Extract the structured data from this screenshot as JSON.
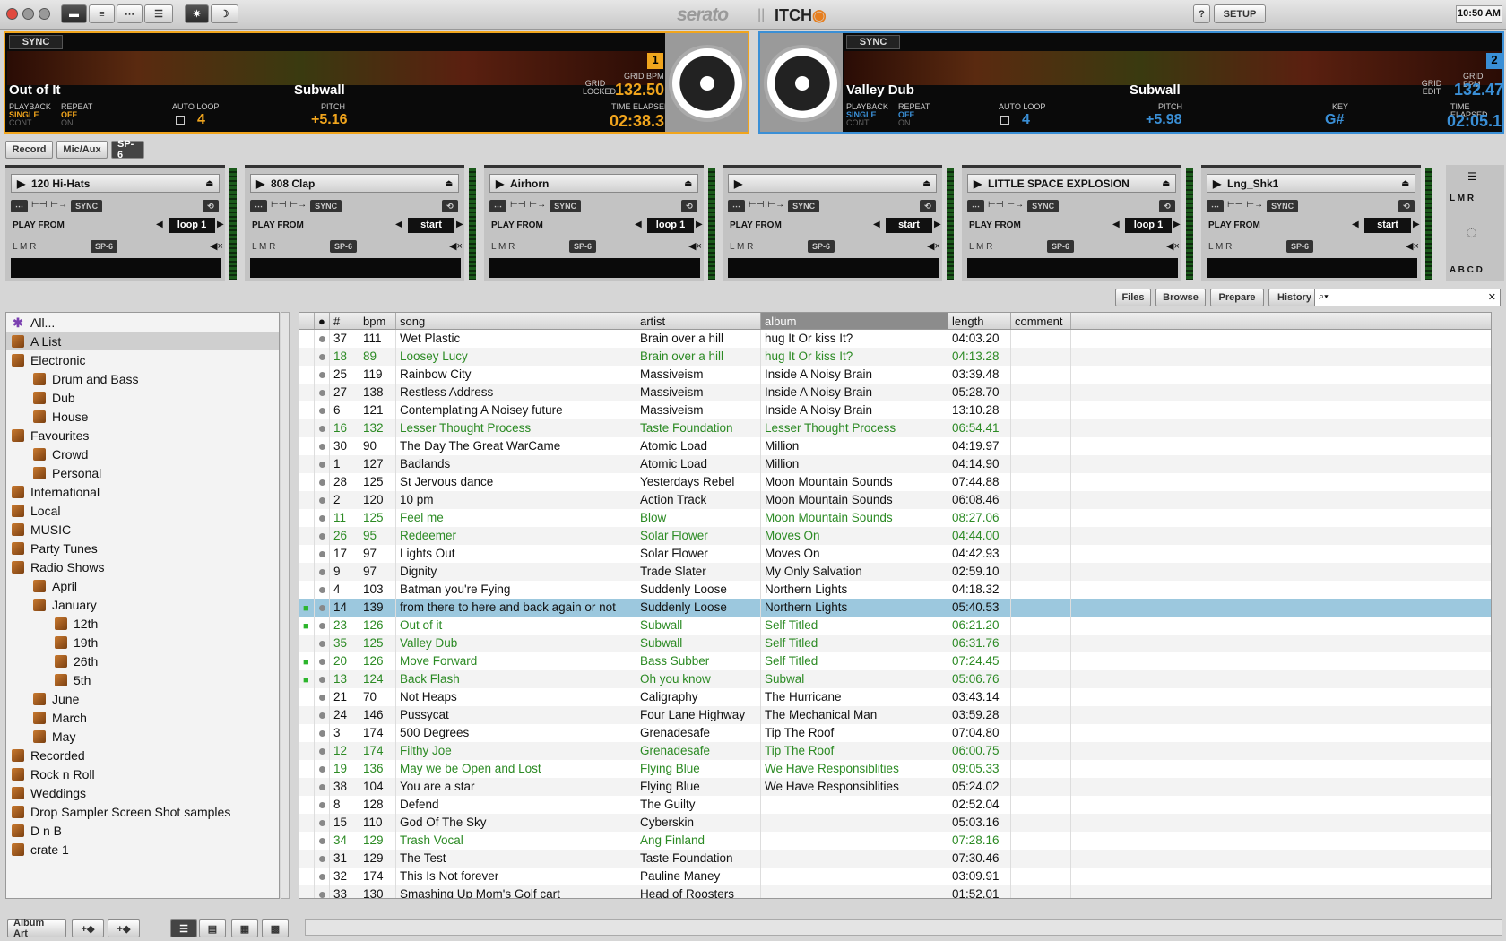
{
  "topbar": {
    "logo": "serato",
    "product": "ITCH",
    "help": "?",
    "setup": "SETUP",
    "clock": "10:50 AM"
  },
  "deck1": {
    "sync": "SYNC",
    "number": "1",
    "title": "Out of It",
    "artist": "Subwall",
    "grid_label": "GRID LOCKED",
    "grid_bpm_label": "GRID BPM",
    "bpm": "132.50",
    "playback_label": "PLAYBACK",
    "playback": "SINGLE",
    "playback2": "CONT",
    "repeat_label": "REPEAT",
    "repeat": "OFF",
    "repeat2": "ON",
    "autoloop_label": "AUTO LOOP",
    "autoloop": "4",
    "pitch_label": "PITCH",
    "pitch": "+5.16",
    "time_label": "TIME ELAPSED",
    "time": "02:38.3"
  },
  "deck2": {
    "sync": "SYNC",
    "number": "2",
    "title": "Valley Dub",
    "artist": "Subwall",
    "grid_label": "GRID EDIT",
    "grid_bpm_label": "GRID BPM",
    "bpm": "132.47",
    "playback_label": "PLAYBACK",
    "playback": "SINGLE",
    "playback2": "CONT",
    "repeat_label": "REPEAT",
    "repeat": "OFF",
    "repeat2": "ON",
    "autoloop_label": "AUTO LOOP",
    "autoloop": "4",
    "pitch_label": "PITCH",
    "pitch": "+5.98",
    "key_label": "KEY",
    "key": "G#",
    "time_label": "TIME ELAPSED",
    "time": "02:05.1"
  },
  "panel_tabs": {
    "record": "Record",
    "micaux": "Mic/Aux",
    "sp6": "SP-6"
  },
  "slots": [
    {
      "name": "120 Hi-Hats",
      "mode": "loop 1"
    },
    {
      "name": "808 Clap",
      "mode": "start"
    },
    {
      "name": "Airhorn",
      "mode": "loop 1"
    },
    {
      "name": "",
      "mode": "start"
    },
    {
      "name": "LITTLE SPACE EXPLOSION",
      "mode": "loop 1"
    },
    {
      "name": "Lng_Shk1",
      "mode": "start"
    }
  ],
  "slot_text": {
    "sync": "SYNC",
    "play_from": "PLAY FROM",
    "lmr": "L M R",
    "sp6": "SP-6"
  },
  "sampler_side": {
    "lmr": "L M R",
    "banks": "A B C D"
  },
  "library_tabs": {
    "files": "Files",
    "browse": "Browse",
    "prepare": "Prepare",
    "history": "History"
  },
  "crates": [
    {
      "label": "All...",
      "level": 0,
      "sel": false
    },
    {
      "label": "A List",
      "level": 0,
      "sel": true
    },
    {
      "label": "Electronic",
      "level": 0
    },
    {
      "label": "Drum and Bass",
      "level": 1
    },
    {
      "label": "Dub",
      "level": 1
    },
    {
      "label": "House",
      "level": 1
    },
    {
      "label": "Favourites",
      "level": 0
    },
    {
      "label": "Crowd",
      "level": 1
    },
    {
      "label": "Personal",
      "level": 1
    },
    {
      "label": "International",
      "level": 0
    },
    {
      "label": "Local",
      "level": 0
    },
    {
      "label": "MUSIC",
      "level": 0
    },
    {
      "label": "Party Tunes",
      "level": 0
    },
    {
      "label": "Radio Shows",
      "level": 0
    },
    {
      "label": "April",
      "level": 1
    },
    {
      "label": "January",
      "level": 1
    },
    {
      "label": "12th",
      "level": 2
    },
    {
      "label": "19th",
      "level": 2
    },
    {
      "label": "26th",
      "level": 2
    },
    {
      "label": "5th",
      "level": 2
    },
    {
      "label": "June",
      "level": 1
    },
    {
      "label": "March",
      "level": 1
    },
    {
      "label": "May",
      "level": 1
    },
    {
      "label": "Recorded",
      "level": 0
    },
    {
      "label": "Rock n Roll",
      "level": 0
    },
    {
      "label": "Weddings",
      "level": 0
    },
    {
      "label": "Drop Sampler Screen Shot samples",
      "level": 0
    },
    {
      "label": "D n B",
      "level": 0
    },
    {
      "label": "crate 1",
      "level": 0
    }
  ],
  "columns": {
    "num": "#",
    "bpm": "bpm",
    "song": "song",
    "artist": "artist",
    "album": "album",
    "length": "length",
    "comment": "comment"
  },
  "tracks": [
    [
      "37",
      "111",
      "Wet Plastic",
      "Brain over a hill",
      "hug It Or kiss It?",
      "04:03.20",
      "n",
      ""
    ],
    [
      "18",
      "89",
      "Loosey Lucy",
      "Brain over a hill",
      "hug It Or kiss It?",
      "04:13.28",
      "g",
      ""
    ],
    [
      "25",
      "119",
      "Rainbow City",
      "Massiveism",
      "Inside A Noisy Brain",
      "03:39.48",
      "n",
      ""
    ],
    [
      "27",
      "138",
      "Restless Address",
      "Massiveism",
      "Inside A Noisy Brain",
      "05:28.70",
      "n",
      ""
    ],
    [
      "6",
      "121",
      "Contemplating A Noisey future",
      "Massiveism",
      "Inside A Noisy Brain",
      "13:10.28",
      "n",
      ""
    ],
    [
      "16",
      "132",
      "Lesser Thought Process",
      "Taste Foundation",
      "Lesser Thought Process",
      "06:54.41",
      "g",
      ""
    ],
    [
      "30",
      "90",
      "The Day The Great WarCame",
      "Atomic Load",
      "Million",
      "04:19.97",
      "n",
      ""
    ],
    [
      "1",
      "127",
      "Badlands",
      "Atomic Load",
      "Million",
      "04:14.90",
      "n",
      ""
    ],
    [
      "28",
      "125",
      "St Jervous dance",
      "Yesterdays Rebel",
      "Moon Mountain Sounds",
      "07:44.88",
      "n",
      ""
    ],
    [
      "2",
      "120",
      "10 pm",
      "Action Track",
      "Moon Mountain Sounds",
      "06:08.46",
      "n",
      ""
    ],
    [
      "11",
      "125",
      "Feel me",
      "Blow",
      "Moon Mountain Sounds",
      "08:27.06",
      "g",
      ""
    ],
    [
      "26",
      "95",
      "Redeemer",
      "Solar Flower",
      "Moves On",
      "04:44.00",
      "g",
      ""
    ],
    [
      "17",
      "97",
      "Lights Out",
      "Solar Flower",
      "Moves On",
      "04:42.93",
      "n",
      ""
    ],
    [
      "9",
      "97",
      "Dignity",
      "Trade Slater",
      "My Only Salvation",
      "02:59.10",
      "n",
      ""
    ],
    [
      "4",
      "103",
      "Batman you're Fying",
      "Suddenly Loose",
      "Northern Lights",
      "04:18.32",
      "n",
      ""
    ],
    [
      "14",
      "139",
      "from there to here and back again or not",
      "Suddenly Loose",
      "Northern Lights",
      "05:40.53",
      "h",
      "L"
    ],
    [
      "23",
      "126",
      "Out of it",
      "Subwall",
      "Self Titled",
      "06:21.20",
      "g",
      "L"
    ],
    [
      "35",
      "125",
      "Valley Dub",
      "Subwall",
      "Self Titled",
      "06:31.76",
      "g",
      ""
    ],
    [
      "20",
      "126",
      "Move Forward",
      "Bass Subber",
      "Self Titled",
      "07:24.45",
      "g",
      "L"
    ],
    [
      "13",
      "124",
      "Back Flash",
      "Oh you know",
      "Subwal",
      "05:06.76",
      "g",
      "L"
    ],
    [
      "21",
      "70",
      "Not Heaps",
      "Caligraphy",
      "The Hurricane",
      "03:43.14",
      "n",
      ""
    ],
    [
      "24",
      "146",
      "Pussycat",
      "Four Lane Highway",
      "The Mechanical Man",
      "03:59.28",
      "n",
      ""
    ],
    [
      "3",
      "174",
      "500 Degrees",
      "Grenadesafe",
      "Tip The Roof",
      "07:04.80",
      "n",
      ""
    ],
    [
      "12",
      "174",
      "Filthy Joe",
      "Grenadesafe",
      "Tip The Roof",
      "06:00.75",
      "g",
      ""
    ],
    [
      "19",
      "136",
      "May we be Open and Lost",
      "Flying Blue",
      "We Have Responsiblities",
      "09:05.33",
      "g",
      ""
    ],
    [
      "38",
      "104",
      "You are a star",
      "Flying Blue",
      "We Have Responsiblities",
      "05:24.02",
      "n",
      ""
    ],
    [
      "8",
      "128",
      "Defend",
      "The Guilty",
      "",
      "02:52.04",
      "n",
      ""
    ],
    [
      "15",
      "110",
      "God Of The Sky",
      "Cyberskin",
      "",
      "05:03.16",
      "n",
      ""
    ],
    [
      "34",
      "129",
      "Trash Vocal",
      "Ang Finland",
      "",
      "07:28.16",
      "g",
      ""
    ],
    [
      "31",
      "129",
      "The Test",
      "Taste Foundation",
      "",
      "07:30.46",
      "n",
      ""
    ],
    [
      "32",
      "174",
      "This Is Not forever",
      "Pauline Maney",
      "",
      "03:09.91",
      "n",
      ""
    ],
    [
      "33",
      "130",
      "Smashing Up Mom's Golf cart",
      "Head of Roosters",
      "",
      "01:52.01",
      "n",
      ""
    ]
  ],
  "bottom": {
    "album_art": "Album Art"
  }
}
